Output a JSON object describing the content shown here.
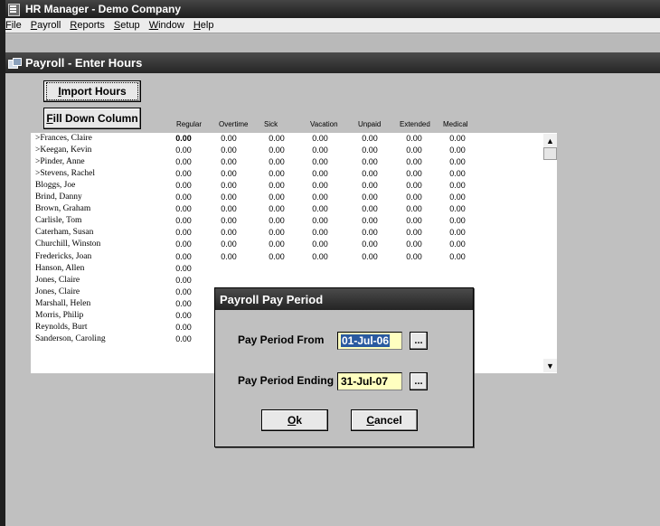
{
  "app": {
    "title": "HR Manager - Demo Company",
    "menu": [
      {
        "prefix": "",
        "ul": "F",
        "rest": "ile"
      },
      {
        "prefix": "",
        "ul": "P",
        "rest": "ayroll"
      },
      {
        "prefix": "",
        "ul": "R",
        "rest": "eports"
      },
      {
        "prefix": "",
        "ul": "S",
        "rest": "etup"
      },
      {
        "prefix": "",
        "ul": "W",
        "rest": "indow"
      },
      {
        "prefix": "",
        "ul": "H",
        "rest": "elp"
      }
    ]
  },
  "child": {
    "title": "Payroll - Enter Hours"
  },
  "buttons": {
    "import": {
      "ul": "I",
      "rest": "mport Hours"
    },
    "filldown": {
      "ul": "F",
      "rest": "ill Down Column"
    }
  },
  "columns": [
    "Regular",
    "Overtime",
    "Sick",
    "Vacation",
    "Unpaid",
    "Extended",
    "Medical"
  ],
  "rows": [
    {
      "name": ">Frances, Claire",
      "values": [
        "0.00",
        "0.00",
        "0.00",
        "0.00",
        "0.00",
        "0.00",
        "0.00"
      ]
    },
    {
      "name": ">Keegan, Kevin",
      "values": [
        "0.00",
        "0.00",
        "0.00",
        "0.00",
        "0.00",
        "0.00",
        "0.00"
      ]
    },
    {
      "name": ">Pinder, Anne",
      "values": [
        "0.00",
        "0.00",
        "0.00",
        "0.00",
        "0.00",
        "0.00",
        "0.00"
      ]
    },
    {
      "name": ">Stevens, Rachel",
      "values": [
        "0.00",
        "0.00",
        "0.00",
        "0.00",
        "0.00",
        "0.00",
        "0.00"
      ]
    },
    {
      "name": "Bloggs, Joe",
      "values": [
        "0.00",
        "0.00",
        "0.00",
        "0.00",
        "0.00",
        "0.00",
        "0.00"
      ]
    },
    {
      "name": "Brind, Danny",
      "values": [
        "0.00",
        "0.00",
        "0.00",
        "0.00",
        "0.00",
        "0.00",
        "0.00"
      ]
    },
    {
      "name": "Brown, Graham",
      "values": [
        "0.00",
        "0.00",
        "0.00",
        "0.00",
        "0.00",
        "0.00",
        "0.00"
      ]
    },
    {
      "name": "Carlisle, Tom",
      "values": [
        "0.00",
        "0.00",
        "0.00",
        "0.00",
        "0.00",
        "0.00",
        "0.00"
      ]
    },
    {
      "name": "Caterham, Susan",
      "values": [
        "0.00",
        "0.00",
        "0.00",
        "0.00",
        "0.00",
        "0.00",
        "0.00"
      ]
    },
    {
      "name": "Churchill, Winston",
      "values": [
        "0.00",
        "0.00",
        "0.00",
        "0.00",
        "0.00",
        "0.00",
        "0.00"
      ]
    },
    {
      "name": "Fredericks, Joan",
      "values": [
        "0.00",
        "0.00",
        "0.00",
        "0.00",
        "0.00",
        "0.00",
        "0.00"
      ]
    },
    {
      "name": "Hanson, Allen",
      "values": [
        "0.00"
      ]
    },
    {
      "name": "Jones, Claire",
      "values": [
        "0.00"
      ]
    },
    {
      "name": "Jones, Claire",
      "values": [
        "0.00"
      ]
    },
    {
      "name": "Marshall, Helen",
      "values": [
        "0.00"
      ]
    },
    {
      "name": "Morris, Philip",
      "values": [
        "0.00"
      ]
    },
    {
      "name": "Reynolds, Burt",
      "values": [
        "0.00"
      ]
    },
    {
      "name": "Sanderson, Caroling",
      "values": [
        "0.00"
      ]
    }
  ],
  "dialog": {
    "title": "Payroll Pay Period",
    "from_label": "Pay Period From",
    "from_value": "01-Jul-06",
    "ending_label": "Pay Period Ending",
    "ending_value": "31-Jul-07",
    "dots": "...",
    "ok": {
      "ul": "O",
      "rest": "k"
    },
    "cancel": {
      "ul": "C",
      "rest": "ancel"
    }
  },
  "icons": {
    "app": "hr-manager-app-icon",
    "child": "payroll-window-icon",
    "scroll_up": "scroll-up-arrow-icon",
    "scroll_down": "scroll-down-arrow-icon"
  },
  "colors": {
    "titlebar": "#2a2a2a",
    "date_field_bg": "#ffffc0",
    "selection": "#2a5aa0"
  }
}
